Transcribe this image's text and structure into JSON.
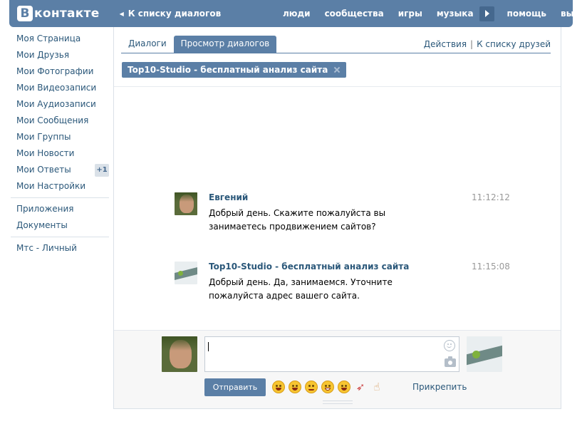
{
  "header": {
    "logo_letter": "В",
    "logo_text": "контакте",
    "back_link": "К списку диалогов",
    "nav": [
      "люди",
      "сообщества",
      "игры",
      "музыка",
      "помощь",
      "выйти"
    ]
  },
  "sidebar": {
    "items": [
      {
        "label": "Моя Страница"
      },
      {
        "label": "Мои Друзья"
      },
      {
        "label": "Мои Фотографии"
      },
      {
        "label": "Мои Видеозаписи"
      },
      {
        "label": "Мои Аудиозаписи"
      },
      {
        "label": "Мои Сообщения"
      },
      {
        "label": "Мои Группы"
      },
      {
        "label": "Мои Новости"
      },
      {
        "label": "Мои Ответы",
        "badge": "+1"
      },
      {
        "label": "Мои Настройки"
      }
    ],
    "apps": [
      "Приложения",
      "Документы"
    ],
    "extra": [
      "Мтс - Личный"
    ]
  },
  "main": {
    "tabs": [
      {
        "label": "Диалоги",
        "active": false
      },
      {
        "label": "Просмотр диалогов",
        "active": true
      }
    ],
    "actions": {
      "left": "Действия",
      "separator": "|",
      "right": "К списку друзей"
    },
    "chip": "Top10-Studio - бесплатный анализ сайта",
    "messages": [
      {
        "author": "Евгений",
        "time": "11:12:12",
        "text": "Добрый день. Скажите пожалуйста вы занимаетесь продвижением сайтов?"
      },
      {
        "author": "Top10-Studio - бесплатный анализ сайта",
        "time": "11:15:08",
        "text": "Добрый день. Да, занимаемся. Уточните пожалуйста адрес вашего сайта."
      }
    ]
  },
  "compose": {
    "value": "",
    "send_label": "Отправить",
    "attach_label": "Прикрепить",
    "emoji": [
      "smile",
      "laugh",
      "wink",
      "grin",
      "joy",
      "rocket",
      "finger-up"
    ]
  }
}
